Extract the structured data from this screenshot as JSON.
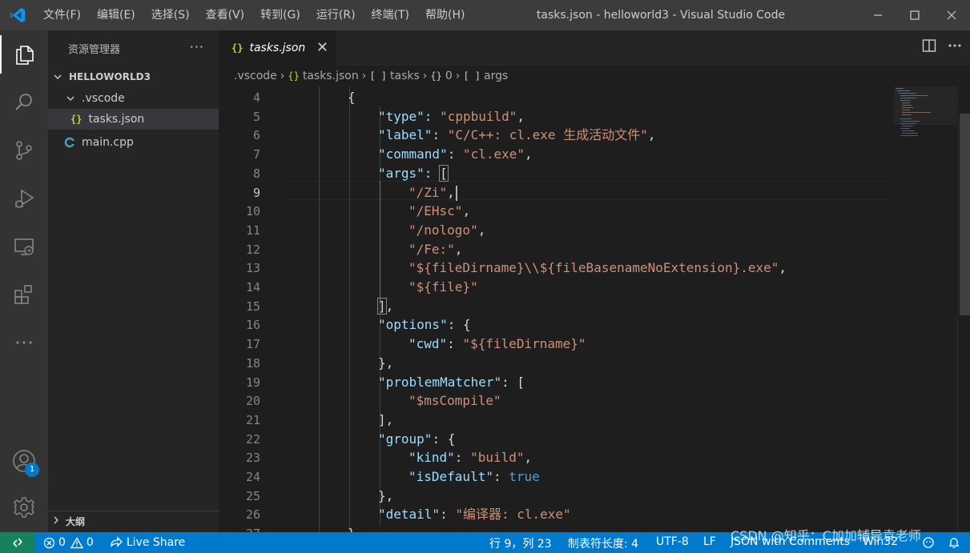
{
  "titlebar": {
    "menus": [
      "文件(F)",
      "编辑(E)",
      "选择(S)",
      "查看(V)",
      "转到(G)",
      "运行(R)",
      "终端(T)",
      "帮助(H)"
    ],
    "window_title": "tasks.json - helloworld3 - Visual Studio Code"
  },
  "activitybar": {
    "items": [
      "explorer-icon",
      "search-icon",
      "source-control-icon",
      "run-debug-icon",
      "remote-explorer-icon",
      "extensions-icon",
      "more-icon"
    ],
    "bottom": [
      "accounts-icon",
      "settings-gear-icon"
    ],
    "accounts_badge": "1"
  },
  "sidebar": {
    "title": "资源管理器",
    "more": "···",
    "root_folder": "HELLOWORLD3",
    "subfolder": ".vscode",
    "files": [
      {
        "name": "tasks.json",
        "selected": true
      },
      {
        "name": "main.cpp",
        "selected": false
      }
    ],
    "outline_label": "大纲"
  },
  "tabs": {
    "active": {
      "label": "tasks.json",
      "close": "✕"
    }
  },
  "breadcrumb": {
    "items": [
      ".vscode",
      "tasks.json",
      "tasks",
      "0",
      "args"
    ],
    "icons": [
      "",
      "{}",
      "[ ]",
      "{}",
      "[ ]"
    ]
  },
  "editor": {
    "current_line": 9,
    "lines": [
      {
        "n": "4",
        "indent": 2,
        "tokens": [
          [
            "p",
            "{"
          ]
        ]
      },
      {
        "n": "5",
        "indent": 3,
        "tokens": [
          [
            "k",
            "\"type\""
          ],
          [
            "p",
            ": "
          ],
          [
            "s",
            "\"cppbuild\""
          ],
          [
            "p",
            ","
          ]
        ]
      },
      {
        "n": "6",
        "indent": 3,
        "tokens": [
          [
            "k",
            "\"label\""
          ],
          [
            "p",
            ": "
          ],
          [
            "s",
            "\"C/C++: cl.exe 生成活动文件\""
          ],
          [
            "p",
            ","
          ]
        ]
      },
      {
        "n": "7",
        "indent": 3,
        "tokens": [
          [
            "k",
            "\"command\""
          ],
          [
            "p",
            ": "
          ],
          [
            "s",
            "\"cl.exe\""
          ],
          [
            "p",
            ","
          ]
        ]
      },
      {
        "n": "8",
        "indent": 3,
        "tokens": [
          [
            "k",
            "\"args\""
          ],
          [
            "p",
            ": "
          ],
          [
            "pb",
            "["
          ]
        ]
      },
      {
        "n": "9",
        "indent": 4,
        "tokens": [
          [
            "s",
            "\"/Zi\""
          ],
          [
            "p",
            ","
          ],
          [
            "c",
            ""
          ]
        ]
      },
      {
        "n": "10",
        "indent": 4,
        "tokens": [
          [
            "s",
            "\"/EHsc\""
          ],
          [
            "p",
            ","
          ]
        ]
      },
      {
        "n": "11",
        "indent": 4,
        "tokens": [
          [
            "s",
            "\"/nologo\""
          ],
          [
            "p",
            ","
          ]
        ]
      },
      {
        "n": "12",
        "indent": 4,
        "tokens": [
          [
            "s",
            "\"/Fe:\""
          ],
          [
            "p",
            ","
          ]
        ]
      },
      {
        "n": "13",
        "indent": 4,
        "tokens": [
          [
            "s",
            "\"${fileDirname}\\\\${fileBasenameNoExtension}.exe\""
          ],
          [
            "p",
            ","
          ]
        ]
      },
      {
        "n": "14",
        "indent": 4,
        "tokens": [
          [
            "s",
            "\"${file}\""
          ]
        ]
      },
      {
        "n": "15",
        "indent": 3,
        "tokens": [
          [
            "pb",
            "]"
          ],
          [
            "p",
            ","
          ]
        ]
      },
      {
        "n": "16",
        "indent": 3,
        "tokens": [
          [
            "k",
            "\"options\""
          ],
          [
            "p",
            ": {"
          ]
        ]
      },
      {
        "n": "17",
        "indent": 4,
        "tokens": [
          [
            "k",
            "\"cwd\""
          ],
          [
            "p",
            ": "
          ],
          [
            "s",
            "\"${fileDirname}\""
          ]
        ]
      },
      {
        "n": "18",
        "indent": 3,
        "tokens": [
          [
            "p",
            "},"
          ]
        ]
      },
      {
        "n": "19",
        "indent": 3,
        "tokens": [
          [
            "k",
            "\"problemMatcher\""
          ],
          [
            "p",
            ": ["
          ]
        ]
      },
      {
        "n": "20",
        "indent": 4,
        "tokens": [
          [
            "s",
            "\"$msCompile\""
          ]
        ]
      },
      {
        "n": "21",
        "indent": 3,
        "tokens": [
          [
            "p",
            "],"
          ]
        ]
      },
      {
        "n": "22",
        "indent": 3,
        "tokens": [
          [
            "k",
            "\"group\""
          ],
          [
            "p",
            ": {"
          ]
        ]
      },
      {
        "n": "23",
        "indent": 4,
        "tokens": [
          [
            "k",
            "\"kind\""
          ],
          [
            "p",
            ": "
          ],
          [
            "s",
            "\"build\""
          ],
          [
            "p",
            ","
          ]
        ]
      },
      {
        "n": "24",
        "indent": 4,
        "tokens": [
          [
            "k",
            "\"isDefault\""
          ],
          [
            "p",
            ": "
          ],
          [
            "b",
            "true"
          ]
        ]
      },
      {
        "n": "25",
        "indent": 3,
        "tokens": [
          [
            "p",
            "},"
          ]
        ]
      },
      {
        "n": "26",
        "indent": 3,
        "tokens": [
          [
            "k",
            "\"detail\""
          ],
          [
            "p",
            ": "
          ],
          [
            "s",
            "\"编译器: cl.exe\""
          ]
        ]
      },
      {
        "n": "27",
        "indent": 2,
        "tokens": [
          [
            "p",
            "}"
          ]
        ]
      }
    ]
  },
  "statusbar": {
    "errors": "0",
    "warnings": "0",
    "live_share": "Live Share",
    "position": "行 9，列 23",
    "tab_size": "制表符长度: 4",
    "encoding": "UTF-8",
    "eol": "LF",
    "language": "JSON with Comments",
    "platform": "Win32"
  },
  "watermark": "CSDN @知乎：C加加辅导袁老师",
  "colors": {
    "accent": "#007acc",
    "remote": "#16825d",
    "key": "#9cdcfe",
    "string": "#ce9178",
    "boolean": "#569cd6",
    "json_icon": "#cbcb41"
  }
}
